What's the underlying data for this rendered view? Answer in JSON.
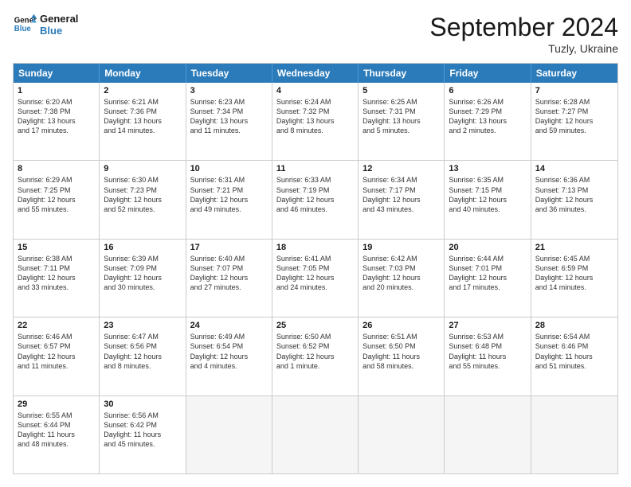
{
  "logo": {
    "line1": "General",
    "line2": "Blue"
  },
  "title": "September 2024",
  "location": "Tuzly, Ukraine",
  "header_days": [
    "Sunday",
    "Monday",
    "Tuesday",
    "Wednesday",
    "Thursday",
    "Friday",
    "Saturday"
  ],
  "weeks": [
    [
      {
        "day": "1",
        "text": "Sunrise: 6:20 AM\nSunset: 7:38 PM\nDaylight: 13 hours\nand 17 minutes."
      },
      {
        "day": "2",
        "text": "Sunrise: 6:21 AM\nSunset: 7:36 PM\nDaylight: 13 hours\nand 14 minutes."
      },
      {
        "day": "3",
        "text": "Sunrise: 6:23 AM\nSunset: 7:34 PM\nDaylight: 13 hours\nand 11 minutes."
      },
      {
        "day": "4",
        "text": "Sunrise: 6:24 AM\nSunset: 7:32 PM\nDaylight: 13 hours\nand 8 minutes."
      },
      {
        "day": "5",
        "text": "Sunrise: 6:25 AM\nSunset: 7:31 PM\nDaylight: 13 hours\nand 5 minutes."
      },
      {
        "day": "6",
        "text": "Sunrise: 6:26 AM\nSunset: 7:29 PM\nDaylight: 13 hours\nand 2 minutes."
      },
      {
        "day": "7",
        "text": "Sunrise: 6:28 AM\nSunset: 7:27 PM\nDaylight: 12 hours\nand 59 minutes."
      }
    ],
    [
      {
        "day": "8",
        "text": "Sunrise: 6:29 AM\nSunset: 7:25 PM\nDaylight: 12 hours\nand 55 minutes."
      },
      {
        "day": "9",
        "text": "Sunrise: 6:30 AM\nSunset: 7:23 PM\nDaylight: 12 hours\nand 52 minutes."
      },
      {
        "day": "10",
        "text": "Sunrise: 6:31 AM\nSunset: 7:21 PM\nDaylight: 12 hours\nand 49 minutes."
      },
      {
        "day": "11",
        "text": "Sunrise: 6:33 AM\nSunset: 7:19 PM\nDaylight: 12 hours\nand 46 minutes."
      },
      {
        "day": "12",
        "text": "Sunrise: 6:34 AM\nSunset: 7:17 PM\nDaylight: 12 hours\nand 43 minutes."
      },
      {
        "day": "13",
        "text": "Sunrise: 6:35 AM\nSunset: 7:15 PM\nDaylight: 12 hours\nand 40 minutes."
      },
      {
        "day": "14",
        "text": "Sunrise: 6:36 AM\nSunset: 7:13 PM\nDaylight: 12 hours\nand 36 minutes."
      }
    ],
    [
      {
        "day": "15",
        "text": "Sunrise: 6:38 AM\nSunset: 7:11 PM\nDaylight: 12 hours\nand 33 minutes."
      },
      {
        "day": "16",
        "text": "Sunrise: 6:39 AM\nSunset: 7:09 PM\nDaylight: 12 hours\nand 30 minutes."
      },
      {
        "day": "17",
        "text": "Sunrise: 6:40 AM\nSunset: 7:07 PM\nDaylight: 12 hours\nand 27 minutes."
      },
      {
        "day": "18",
        "text": "Sunrise: 6:41 AM\nSunset: 7:05 PM\nDaylight: 12 hours\nand 24 minutes."
      },
      {
        "day": "19",
        "text": "Sunrise: 6:42 AM\nSunset: 7:03 PM\nDaylight: 12 hours\nand 20 minutes."
      },
      {
        "day": "20",
        "text": "Sunrise: 6:44 AM\nSunset: 7:01 PM\nDaylight: 12 hours\nand 17 minutes."
      },
      {
        "day": "21",
        "text": "Sunrise: 6:45 AM\nSunset: 6:59 PM\nDaylight: 12 hours\nand 14 minutes."
      }
    ],
    [
      {
        "day": "22",
        "text": "Sunrise: 6:46 AM\nSunset: 6:57 PM\nDaylight: 12 hours\nand 11 minutes."
      },
      {
        "day": "23",
        "text": "Sunrise: 6:47 AM\nSunset: 6:56 PM\nDaylight: 12 hours\nand 8 minutes."
      },
      {
        "day": "24",
        "text": "Sunrise: 6:49 AM\nSunset: 6:54 PM\nDaylight: 12 hours\nand 4 minutes."
      },
      {
        "day": "25",
        "text": "Sunrise: 6:50 AM\nSunset: 6:52 PM\nDaylight: 12 hours\nand 1 minute."
      },
      {
        "day": "26",
        "text": "Sunrise: 6:51 AM\nSunset: 6:50 PM\nDaylight: 11 hours\nand 58 minutes."
      },
      {
        "day": "27",
        "text": "Sunrise: 6:53 AM\nSunset: 6:48 PM\nDaylight: 11 hours\nand 55 minutes."
      },
      {
        "day": "28",
        "text": "Sunrise: 6:54 AM\nSunset: 6:46 PM\nDaylight: 11 hours\nand 51 minutes."
      }
    ],
    [
      {
        "day": "29",
        "text": "Sunrise: 6:55 AM\nSunset: 6:44 PM\nDaylight: 11 hours\nand 48 minutes."
      },
      {
        "day": "30",
        "text": "Sunrise: 6:56 AM\nSunset: 6:42 PM\nDaylight: 11 hours\nand 45 minutes."
      },
      {
        "day": "",
        "text": ""
      },
      {
        "day": "",
        "text": ""
      },
      {
        "day": "",
        "text": ""
      },
      {
        "day": "",
        "text": ""
      },
      {
        "day": "",
        "text": ""
      }
    ]
  ]
}
